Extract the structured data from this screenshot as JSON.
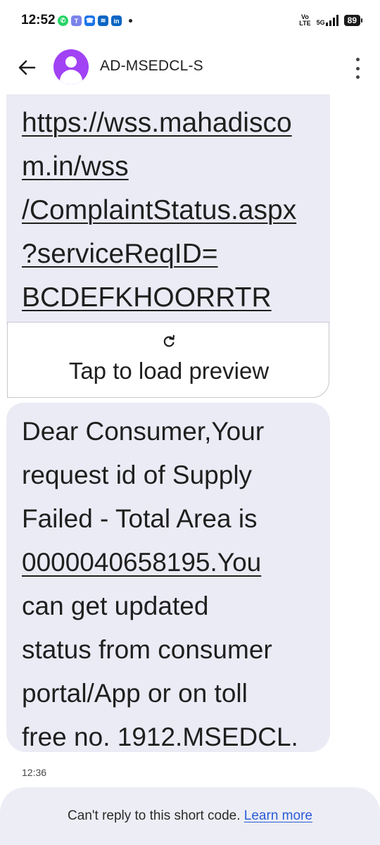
{
  "status_bar": {
    "time": "12:52",
    "volte_line1": "Vo",
    "volte_line2": "LTE",
    "network": "5G",
    "battery": "89",
    "notification_icons": [
      "whatsapp-icon",
      "teams-icon",
      "phone-app-icon",
      "messenger-icon",
      "linkedin-icon"
    ]
  },
  "header": {
    "contact_name": "AD-MSEDCL-S"
  },
  "messages": {
    "link_lines": [
      "https://wss.mahadisco",
      "m.in/wss",
      "/ComplaintStatus.aspx",
      "?serviceReqID=",
      "BCDEFKHOORRTR"
    ],
    "preview_label": "Tap to load preview",
    "body_lines": [
      "Dear Consumer,Your",
      "request id of Supply",
      "Failed - Total Area is",
      "0000040658195.You",
      "can get updated",
      "status from consumer",
      "portal/App or on toll",
      "free no. 1912.MSEDCL."
    ],
    "timestamp": "12:36"
  },
  "footer": {
    "reply_notice": "Can't reply to this short code.",
    "learn_more": "Learn more"
  },
  "colors": {
    "bubble": "#ebebf6",
    "avatar": "#a142f4",
    "link": "#2a5bd7"
  }
}
